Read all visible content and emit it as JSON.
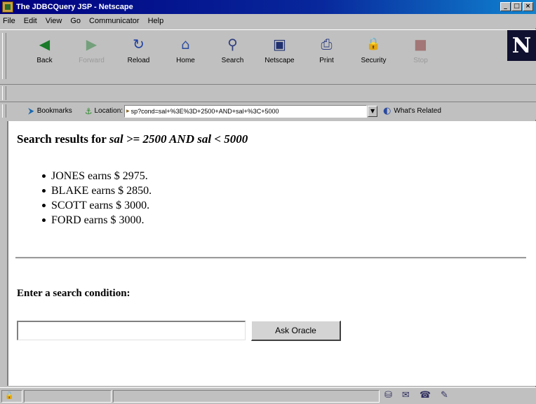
{
  "window": {
    "title": "The JDBCQuery JSP - Netscape",
    "controls": {
      "minimize": "_",
      "maximize": "□",
      "close": "×"
    }
  },
  "menu": [
    "File",
    "Edit",
    "View",
    "Go",
    "Communicator",
    "Help"
  ],
  "toolbar": {
    "buttons": [
      {
        "label": "Back",
        "icon": "back-arrow-icon",
        "glyph": "◀",
        "enabled": true
      },
      {
        "label": "Forward",
        "icon": "forward-arrow-icon",
        "glyph": "▶",
        "enabled": false
      },
      {
        "label": "Reload",
        "icon": "reload-icon",
        "glyph": "↻",
        "enabled": true
      },
      {
        "label": "Home",
        "icon": "home-icon",
        "glyph": "⌂",
        "enabled": true
      },
      {
        "label": "Search",
        "icon": "search-icon",
        "glyph": "⚲",
        "enabled": true
      },
      {
        "label": "Netscape",
        "icon": "netscape-icon",
        "glyph": "▣",
        "enabled": true
      },
      {
        "label": "Print",
        "icon": "print-icon",
        "glyph": "⎙",
        "enabled": true
      },
      {
        "label": "Security",
        "icon": "lock-icon",
        "glyph": "🔒",
        "enabled": true
      },
      {
        "label": "Stop",
        "icon": "stop-icon",
        "glyph": "■",
        "enabled": false
      }
    ],
    "logo_letter": "N"
  },
  "location_bar": {
    "bookmarks_label": "Bookmarks",
    "location_label": "Location:",
    "url": "sp?cond=sal+%3E%3D+2500+AND+sal+%3C+5000",
    "whats_related_label": "What's Related"
  },
  "content": {
    "heading_prefix": "Search results for",
    "heading_query": "sal >= 2500 AND sal < 5000",
    "results": [
      "JONES earns $ 2975.",
      "BLAKE earns $ 2850.",
      "SCOTT earns $ 3000.",
      "FORD earns $ 3000."
    ],
    "prompt": "Enter a search condition:",
    "input_value": "",
    "button_label": "Ask Oracle"
  },
  "colors": {
    "titlebar_start": "#000080",
    "titlebar_end": "#1084d0",
    "chrome": "#c0c0c0"
  }
}
